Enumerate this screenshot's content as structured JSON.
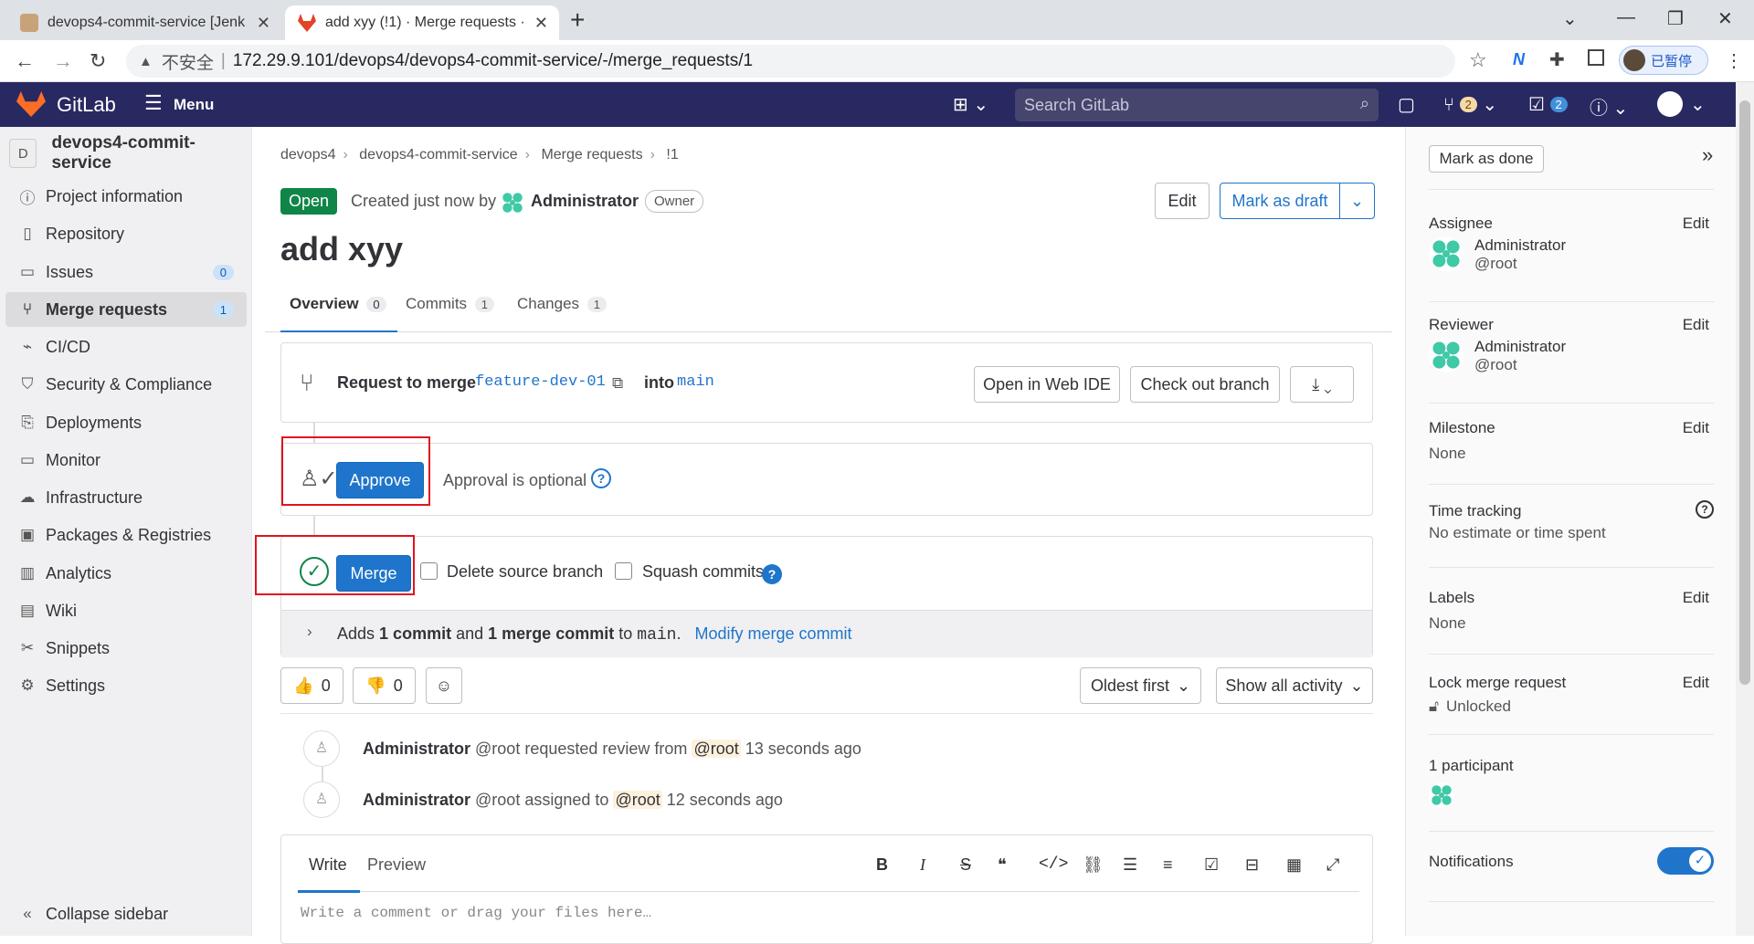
{
  "browser": {
    "tabs": [
      {
        "title": "devops4-commit-service [Jenk"
      },
      {
        "title": "add xyy (!1) · Merge requests ·"
      }
    ],
    "url_security": "不安全",
    "url": "172.29.9.101/devops4/devops4-commit-service/-/merge_requests/1",
    "profile_label": "已暂停"
  },
  "header": {
    "brand": "GitLab",
    "menu_label": "Menu",
    "search_placeholder": "Search GitLab",
    "mr_count": "2",
    "todo_count": "2"
  },
  "sidebar": {
    "project_initial": "D",
    "project_name": "devops4-commit-service",
    "items": [
      {
        "label": "Project information",
        "icon": "info-icon"
      },
      {
        "label": "Repository",
        "icon": "file-icon"
      },
      {
        "label": "Issues",
        "icon": "issues-icon",
        "count": "0"
      },
      {
        "label": "Merge requests",
        "icon": "merge-request-icon",
        "count": "1"
      },
      {
        "label": "CI/CD",
        "icon": "rocket-icon"
      },
      {
        "label": "Security & Compliance",
        "icon": "shield-icon"
      },
      {
        "label": "Deployments",
        "icon": "deployments-icon"
      },
      {
        "label": "Monitor",
        "icon": "monitor-icon"
      },
      {
        "label": "Infrastructure",
        "icon": "cloud-icon"
      },
      {
        "label": "Packages & Registries",
        "icon": "package-icon"
      },
      {
        "label": "Analytics",
        "icon": "chart-icon"
      },
      {
        "label": "Wiki",
        "icon": "book-icon"
      },
      {
        "label": "Snippets",
        "icon": "snippet-icon"
      },
      {
        "label": "Settings",
        "icon": "gear-icon"
      }
    ],
    "collapse_label": "Collapse sidebar"
  },
  "breadcrumb": [
    "devops4",
    "devops4-commit-service",
    "Merge requests",
    "!1"
  ],
  "mr": {
    "status": "Open",
    "created_text": "Created just now by",
    "author": "Administrator",
    "role": "Owner",
    "edit_label": "Edit",
    "draft_label": "Mark as draft",
    "title": "add xyy",
    "tabs": [
      {
        "label": "Overview",
        "count": "0"
      },
      {
        "label": "Commits",
        "count": "1"
      },
      {
        "label": "Changes",
        "count": "1"
      }
    ],
    "request_text": "Request to merge",
    "source_branch": "feature-dev-01",
    "into_text": "into",
    "target_branch": "main",
    "web_ide_label": "Open in Web IDE",
    "checkout_label": "Check out branch",
    "approve_label": "Approve",
    "approval_text": "Approval is optional",
    "merge_label": "Merge",
    "delete_branch_label": "Delete source branch",
    "squash_label": "Squash commits",
    "adds_text": "Adds",
    "commit_count": "1 commit",
    "and_text": "and",
    "merge_commit_count": "1 merge commit",
    "to_text": "to",
    "to_branch": "main",
    "modify_label": "Modify merge commit",
    "thumbs_up": "0",
    "thumbs_down": "0",
    "sort_label": "Oldest first",
    "filter_label": "Show all activity",
    "activity": [
      {
        "user": "Administrator",
        "handle": "@root",
        "action": "requested review from",
        "target": "@root",
        "time": "13 seconds ago"
      },
      {
        "user": "Administrator",
        "handle": "@root",
        "action": "assigned to",
        "target": "@root",
        "time": "12 seconds ago"
      }
    ],
    "write_tab": "Write",
    "preview_tab": "Preview",
    "comment_placeholder": "Write a comment or drag your files here…"
  },
  "right_sidebar": {
    "mark_done": "Mark as done",
    "assignee_label": "Assignee",
    "assignee_name": "Administrator",
    "assignee_handle": "@root",
    "reviewer_label": "Reviewer",
    "reviewer_name": "Administrator",
    "reviewer_handle": "@root",
    "milestone_label": "Milestone",
    "milestone_value": "None",
    "time_label": "Time tracking",
    "time_value": "No estimate or time spent",
    "labels_label": "Labels",
    "labels_value": "None",
    "lock_label": "Lock merge request",
    "lock_value": "Unlocked",
    "participants_label": "1 participant",
    "notifications_label": "Notifications",
    "edit_label": "Edit"
  },
  "colors": {
    "header_bg": "#292961",
    "primary": "#1f75cb",
    "success": "#108548",
    "highlight_box": "#e0141e"
  }
}
